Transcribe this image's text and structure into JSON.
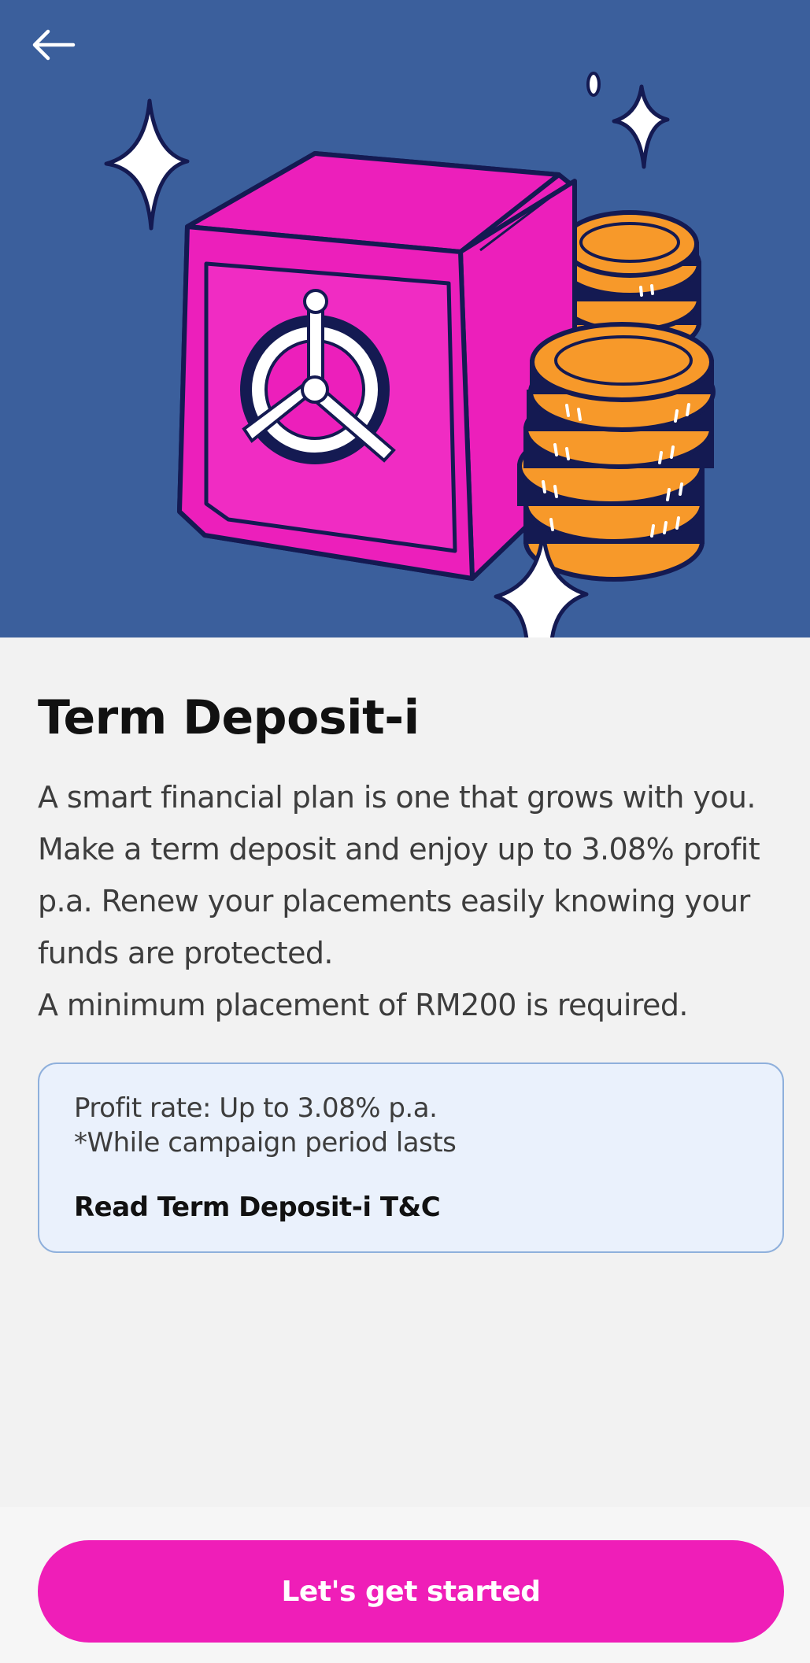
{
  "header": {
    "back_icon": "arrow-left-icon",
    "illustration": "safe-with-coins-illustration"
  },
  "main": {
    "title": "Term Deposit-i",
    "description_lines": [
      "A smart financial plan is one that grows with you.",
      "Make a term deposit and enjoy up to 3.08% profit",
      "p.a. Renew your placements easily knowing your",
      "funds are protected.",
      "A minimum placement of RM200 is required."
    ]
  },
  "info_box": {
    "profit_rate": "Profit rate: Up to 3.08% p.a.",
    "campaign_note": "*While campaign period lasts",
    "tnc_link": "Read Term Deposit-i T&C"
  },
  "footer": {
    "cta_label": "Let's get started"
  },
  "colors": {
    "hero_background": "#3b5f9c",
    "accent_pink": "#ef1eb8",
    "coin_orange": "#f7992a",
    "outline_navy": "#141a52",
    "info_box_background": "#eaf1fc",
    "info_box_border": "#8fb0dc",
    "page_background": "#f2f2f2"
  }
}
